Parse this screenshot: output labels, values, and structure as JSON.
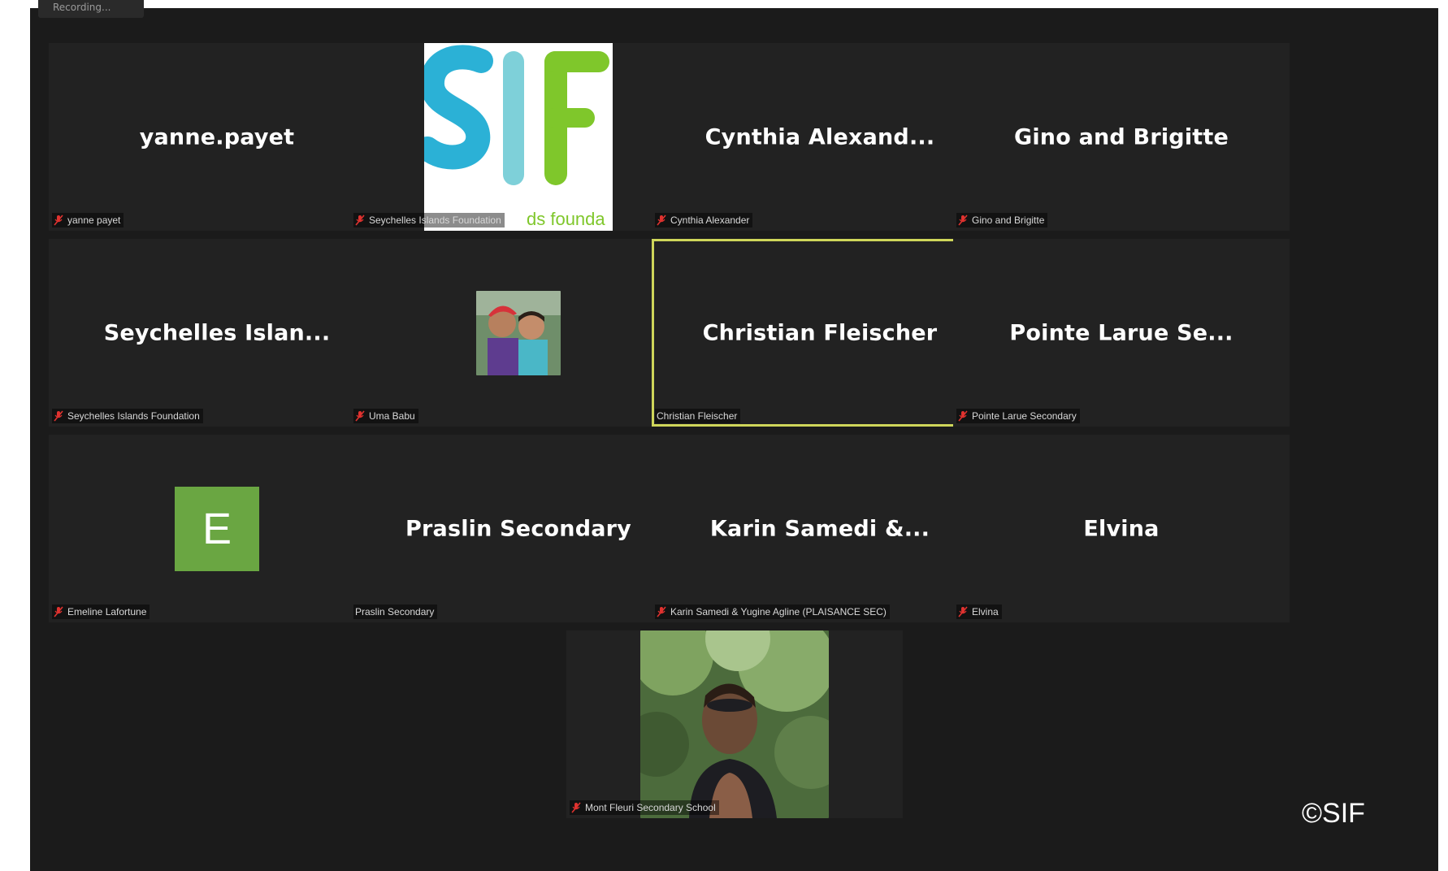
{
  "recording_chip": {
    "label": "Recording..."
  },
  "tiles": [
    {
      "display_name": "yanne.payet",
      "label": "yanne payet"
    },
    {
      "display_name": "",
      "label": "Seychelles Islands Foundation",
      "logo_text": "SIF",
      "logo_subtext": "Seychelles Islands Foundation"
    },
    {
      "display_name": "Cynthia Alexand...",
      "label": "Cynthia Alexander"
    },
    {
      "display_name": "Gino and Brigitte",
      "label": "Gino and Brigitte"
    },
    {
      "display_name": "Seychelles Islan...",
      "label": "Seychelles Islands Foundation"
    },
    {
      "display_name": "",
      "label": "Uma Babu"
    },
    {
      "display_name": "Christian Fleischer",
      "label": "Christian Fleischer"
    },
    {
      "display_name": "Pointe Larue Se...",
      "label": "Pointe Larue Secondary"
    },
    {
      "display_name": "",
      "label": "Emeline Lafortune",
      "avatar_letter": "E"
    },
    {
      "display_name": "Praslin Secondary",
      "label": "Praslin Secondary"
    },
    {
      "display_name": "Karin Samedi &...",
      "label": "Karin Samedi & Yugine Agline (PLAISANCE SEC)"
    },
    {
      "display_name": "Elvina",
      "label": "Elvina"
    },
    {
      "display_name": "",
      "label": "Mont Fleuri Secondary School"
    }
  ],
  "copyright": "©SIF",
  "colors": {
    "background": "#1b1b1b",
    "tile": "#222222",
    "active_speaker": "#cfd65a",
    "muted_mic": "#e0322f",
    "avatar_green": "#6aa642",
    "sif_blue": "#2bb1d6",
    "sif_green": "#7fc72b"
  }
}
